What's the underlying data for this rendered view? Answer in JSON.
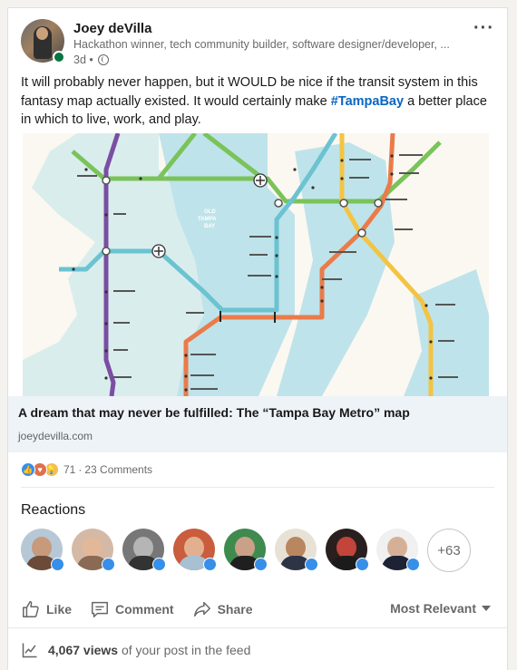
{
  "post": {
    "author": {
      "name": "Joey deVilla",
      "headline": "Hackathon winner, tech community builder, software designer/developer, ...",
      "age": "3d •"
    },
    "text_before": "It will probably never happen, but it WOULD be nice if the transit system in this fantasy map actually existed. It would certainly make ",
    "hashtag": "#TampaBay",
    "text_after": " a better place in which to live, work, and play.",
    "link_preview": {
      "title": "A dream that may never be fulfilled: The “Tampa Bay Metro” map",
      "domain": "joeydevilla.com"
    },
    "map": {
      "water_label_1": "OLD",
      "water_label_2": "TAMPA",
      "water_label_3": "BAY",
      "line_colors": {
        "green": "#7ac35a",
        "purple": "#7a4ea3",
        "blue": "#6bc3d1",
        "orange": "#ea7b4a",
        "yellow": "#f3c443"
      }
    }
  },
  "social": {
    "reaction_count": "71",
    "separator": "·",
    "comments": "23 Comments",
    "reaction_icons": [
      "like-icon",
      "love-icon",
      "insightful-icon"
    ]
  },
  "reactions": {
    "title": "Reactions",
    "more_count": "+63"
  },
  "actions": {
    "like": "Like",
    "comment": "Comment",
    "share": "Share",
    "sort": "Most Relevant"
  },
  "views": {
    "count": "4,067 views",
    "suffix": "of your post in the feed"
  }
}
